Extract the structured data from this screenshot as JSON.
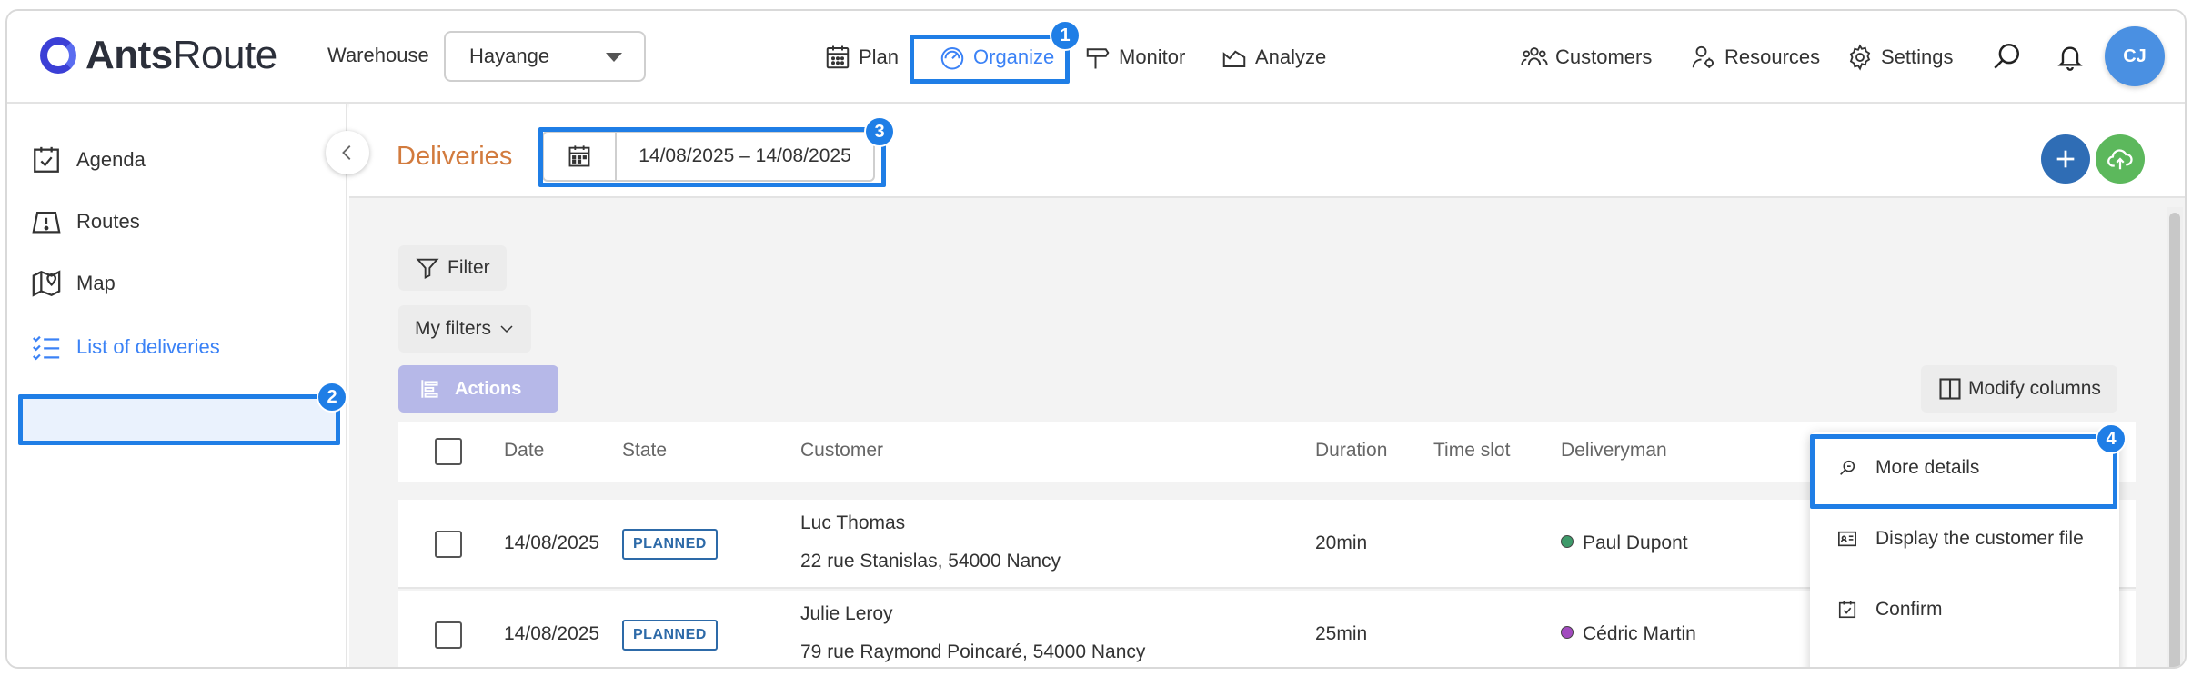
{
  "app": {
    "logo_bold": "Ants",
    "logo_regular": "Route",
    "brand_color": "#3b3fd6"
  },
  "warehouse": {
    "label": "Warehouse",
    "selected": "Hayange"
  },
  "nav": {
    "plan": "Plan",
    "organize": "Organize",
    "monitor": "Monitor",
    "analyze": "Analyze",
    "customers": "Customers",
    "resources": "Resources",
    "settings": "Settings",
    "avatar_initials": "CJ",
    "active": "organize",
    "active_color": "#3b82f6"
  },
  "sidebar": {
    "items": [
      {
        "label": "Agenda",
        "icon": "calendar-check-icon"
      },
      {
        "label": "Routes",
        "icon": "map-warning-icon"
      },
      {
        "label": "Map",
        "icon": "map-pin-icon"
      },
      {
        "label": "List of deliveries",
        "icon": "checklist-icon",
        "active": true
      }
    ]
  },
  "header": {
    "title": "Deliveries",
    "date_range": "14/08/2025 – 14/08/2025",
    "add_color": "#2f6db5",
    "upload_color": "#5cb85c"
  },
  "toolbar": {
    "filter": "Filter",
    "my_filters": "My filters",
    "actions": "Actions",
    "modify_columns": "Modify columns"
  },
  "table": {
    "columns": [
      "Date",
      "State",
      "Customer",
      "Duration",
      "Time slot",
      "Deliveryman"
    ],
    "rows": [
      {
        "date": "14/08/2025",
        "state": "PLANNED",
        "customer_name": "Luc Thomas",
        "customer_address": "22 rue Stanislas, 54000 Nancy",
        "duration": "20min",
        "time_slot": "",
        "deliveryman": "Paul Dupont",
        "deliveryman_color": "#3e9a6a"
      },
      {
        "date": "14/08/2025",
        "state": "PLANNED",
        "customer_name": "Julie Leroy",
        "customer_address": "79 rue Raymond Poincaré, 54000 Nancy",
        "duration": "25min",
        "time_slot": "",
        "deliveryman": "Cédric Martin",
        "deliveryman_color": "#a24bbf"
      }
    ]
  },
  "context_menu": {
    "items": [
      {
        "label": "More details",
        "icon": "zoom-search-icon"
      },
      {
        "label": "Display the customer file",
        "icon": "id-card-icon"
      },
      {
        "label": "Confirm",
        "icon": "calendar-confirm-icon"
      }
    ]
  },
  "annotations": {
    "badge_1": "1",
    "badge_2": "2",
    "badge_3": "3",
    "badge_4": "4",
    "highlight_color": "#1f7ee6"
  }
}
